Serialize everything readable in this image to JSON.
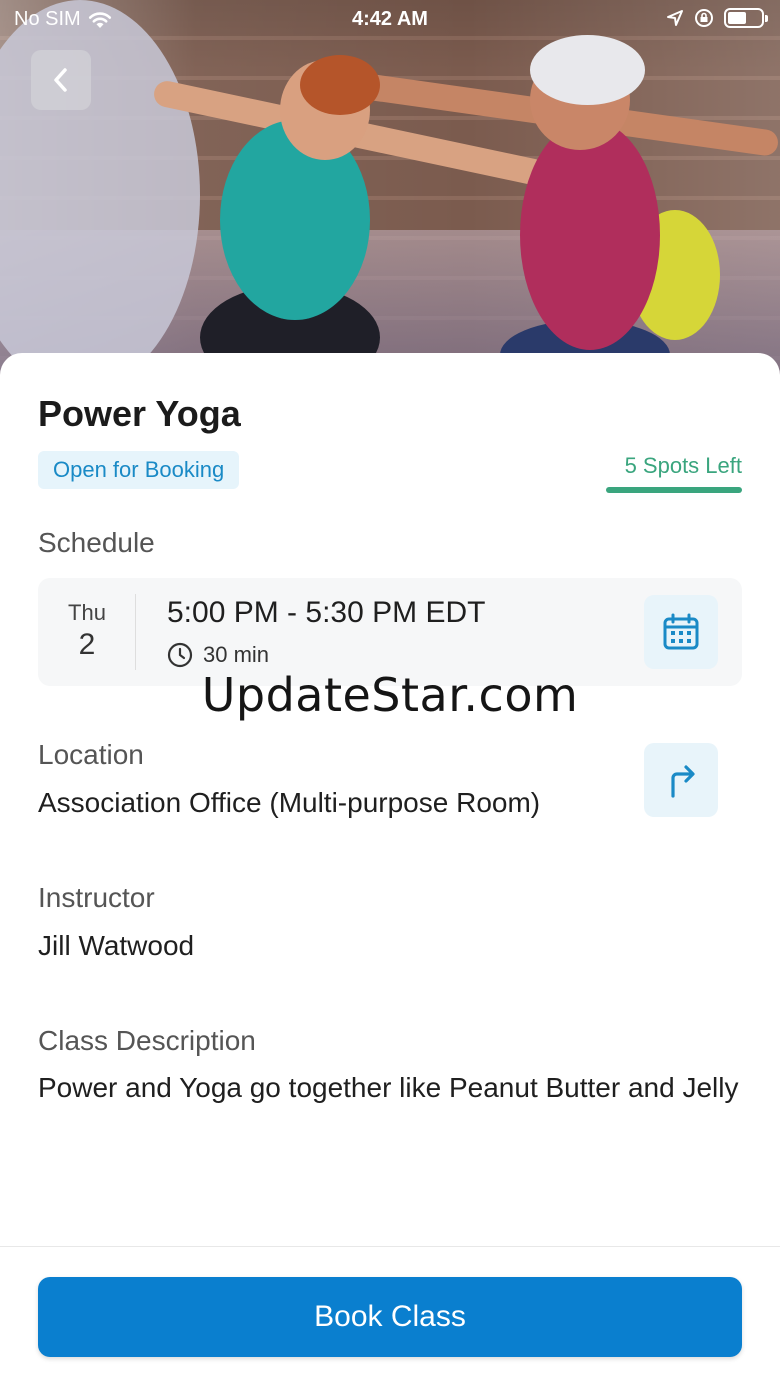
{
  "status_bar": {
    "carrier": "No SIM",
    "time": "4:42 AM",
    "icons": [
      "wifi-icon",
      "location-arrow-icon",
      "rotation-lock-icon",
      "battery-icon"
    ]
  },
  "hero": {
    "image": "yoga-class-photo"
  },
  "class": {
    "title": "Power Yoga",
    "status_badge": "Open for Booking",
    "spots_left": "5 Spots Left"
  },
  "schedule": {
    "label": "Schedule",
    "day": "Thu",
    "date": "2",
    "time_range": "5:00 PM - 5:30 PM EDT",
    "duration": "30 min",
    "calendar_icon": "calendar-icon",
    "clock_icon": "clock-icon"
  },
  "watermark": "UpdateStar.com",
  "location": {
    "label": "Location",
    "value": "Association Office (Multi-purpose Room)",
    "directions_icon": "directions-arrow-icon"
  },
  "instructor": {
    "label": "Instructor",
    "value": "Jill Watwood"
  },
  "description": {
    "label": "Class Description",
    "value": "Power and Yoga go together like Peanut Butter and Jelly"
  },
  "actions": {
    "book_label": "Book Class"
  },
  "colors": {
    "primary": "#0a7fcf",
    "badge_bg": "#e6f4fb",
    "badge_text": "#1a8ac6",
    "spots_green": "#3aa57e"
  }
}
